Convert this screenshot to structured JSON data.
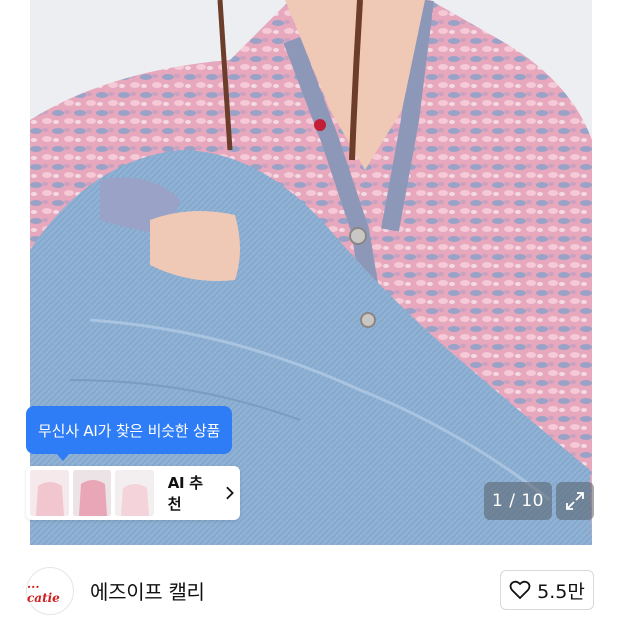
{
  "ai_tooltip": {
    "text": "무신사 AI가 찾은 비슷한 상품"
  },
  "ai_recommend": {
    "label": "AI 추천",
    "thumbnail_colors": [
      "#f2c6cf",
      "#e8a6b6",
      "#f4d3da"
    ],
    "accent": "#2e7cf6"
  },
  "pager": {
    "current": "1",
    "separator": " / ",
    "total": "10"
  },
  "brand": {
    "logo_text": "... catie",
    "name": "에즈이프 캘리",
    "logo_color": "#d11d1d"
  },
  "like": {
    "count": "5.5만"
  }
}
